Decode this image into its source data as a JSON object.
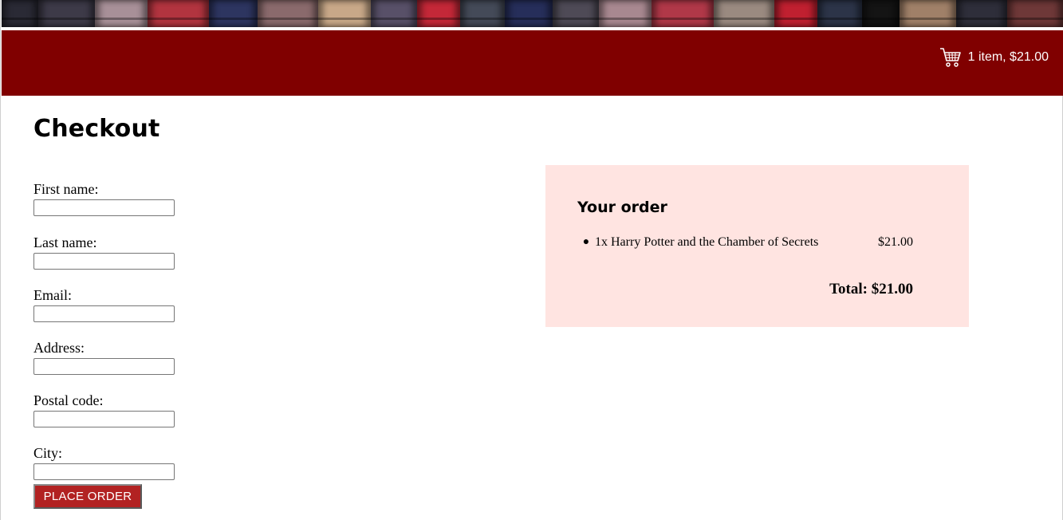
{
  "header": {
    "cart_label": "1 item, $21.00"
  },
  "colors": {
    "header_bg": "#800000",
    "button_bg": "#b22222",
    "order_panel_bg": "#ffe4e1"
  },
  "banner": {
    "spine_colors": [
      "#2a2a35",
      "#3d3a48",
      "#a89098",
      "#b2343f",
      "#2d3560",
      "#8a6a6c",
      "#c8a888",
      "#585068",
      "#c42838",
      "#444a58",
      "#262e5a",
      "#4e4a56",
      "#a88890",
      "#b03848",
      "#9a8a80",
      "#c02030",
      "#2c3448",
      "#141414",
      "#a08068",
      "#2e2e3a",
      "#6e3838"
    ]
  },
  "checkout": {
    "title": "Checkout",
    "fields": [
      {
        "label": "First name:",
        "value": ""
      },
      {
        "label": "Last name:",
        "value": ""
      },
      {
        "label": "Email:",
        "value": ""
      },
      {
        "label": "Address:",
        "value": ""
      },
      {
        "label": "Postal code:",
        "value": ""
      },
      {
        "label": "City:",
        "value": ""
      }
    ],
    "submit_label": "PLACE ORDER"
  },
  "order": {
    "title": "Your order",
    "items": [
      {
        "name": "1x Harry Potter and the Chamber of Secrets",
        "price": "$21.00"
      }
    ],
    "total": "Total: $21.00"
  }
}
